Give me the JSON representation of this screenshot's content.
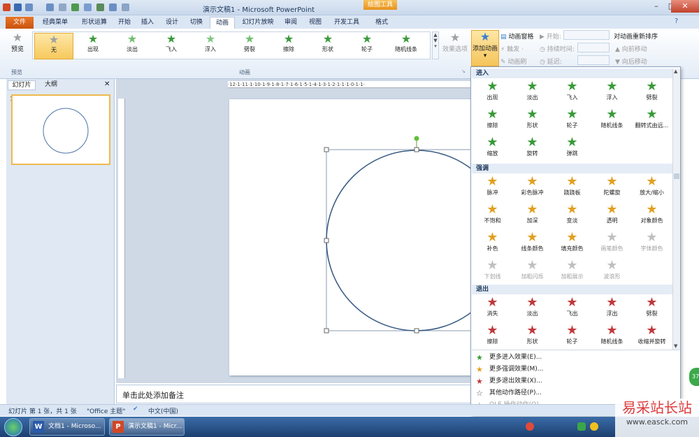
{
  "window": {
    "title": "演示文稿1 - Microsoft PowerPoint",
    "context_tab_group": "绘图工具"
  },
  "tabs": [
    "文件",
    "经典菜单",
    "形状运算",
    "开始",
    "插入",
    "设计",
    "切换",
    "动画",
    "幻灯片放映",
    "审阅",
    "视图",
    "开发工具",
    "格式"
  ],
  "active_tab": "动画",
  "ribbon": {
    "preview": {
      "label": "预览",
      "group_label": "预览"
    },
    "animation_gallery": {
      "group_label": "动画",
      "items": [
        {
          "label": "无",
          "selected": true
        },
        {
          "label": "出现"
        },
        {
          "label": "淡出"
        },
        {
          "label": "飞入"
        },
        {
          "label": "浮入"
        },
        {
          "label": "劈裂"
        },
        {
          "label": "擦除"
        },
        {
          "label": "形状"
        },
        {
          "label": "轮子"
        },
        {
          "label": "随机线条"
        }
      ]
    },
    "effect_options": {
      "label": "效果选项"
    },
    "add_animation": {
      "label": "添加动画"
    },
    "animation_pane": {
      "label": "动画窗格"
    },
    "trigger": {
      "label": "触发 ·"
    },
    "animation_painter": {
      "label": "动画刷"
    },
    "start": {
      "label": "开始:"
    },
    "duration": {
      "label": "持续时间:"
    },
    "delay": {
      "label": "延迟:"
    },
    "reorder": {
      "title": "对动画重新排序",
      "move_earlier": "向前移动",
      "move_later": "向后移动"
    }
  },
  "left_pane": {
    "tabs": [
      "幻灯片",
      "大纲"
    ],
    "close_glyph": "✕",
    "slide_number": "1"
  },
  "ruler_text": "·12·1·11·1·10·1·9·1·8·1·7·1·6·1·5·1·4·1·3·1·2·1·1·1·0·1·1·",
  "notes_placeholder": "单击此处添加备注",
  "dropdown": {
    "sections": [
      {
        "title": "进入",
        "color": "#3a9a3a",
        "items": [
          "出现",
          "淡出",
          "飞入",
          "浮入",
          "劈裂",
          "擦除",
          "形状",
          "轮子",
          "随机线条",
          "翻转式由远...",
          "缩放",
          "旋转",
          "弹跳"
        ]
      },
      {
        "title": "强调",
        "color": "#e0a020",
        "items": [
          "脉冲",
          "彩色脉冲",
          "跷跷板",
          "陀螺旋",
          "放大/缩小",
          "不饱和",
          "加深",
          "变淡",
          "透明",
          "对象颜色",
          "补色",
          "线条颜色",
          "填充颜色",
          "画笔颜色",
          "字体颜色",
          "下划线",
          "加粗闪烁",
          "加粗展示",
          "波浪形"
        ]
      },
      {
        "title": "退出",
        "color": "#c0393b",
        "items": [
          "消失",
          "淡出",
          "飞出",
          "浮出",
          "劈裂",
          "擦除",
          "形状",
          "轮子",
          "随机线条",
          "收缩并旋转"
        ]
      }
    ],
    "more": [
      {
        "label": "更多进入效果(E)...",
        "icon": "green-star"
      },
      {
        "label": "更多强调效果(M)...",
        "icon": "yellow-star"
      },
      {
        "label": "更多退出效果(X)...",
        "icon": "red-star"
      },
      {
        "label": "其他动作路径(P)...",
        "icon": "outline-star"
      },
      {
        "label": "OLE 操作动作(O)",
        "icon": "grey-star",
        "disabled": true
      }
    ]
  },
  "status": {
    "slide": "幻灯片 第 1 张，共 1 张",
    "theme": "\"Office 主题\"",
    "lang": "中文(中国)"
  },
  "taskbar": {
    "word": "文档1 - Microso...",
    "ppt": "演示文稿1 - Micr..."
  },
  "watermark": {
    "line1": "易采站长站",
    "line2": "www.easck.com"
  },
  "badge": "37"
}
